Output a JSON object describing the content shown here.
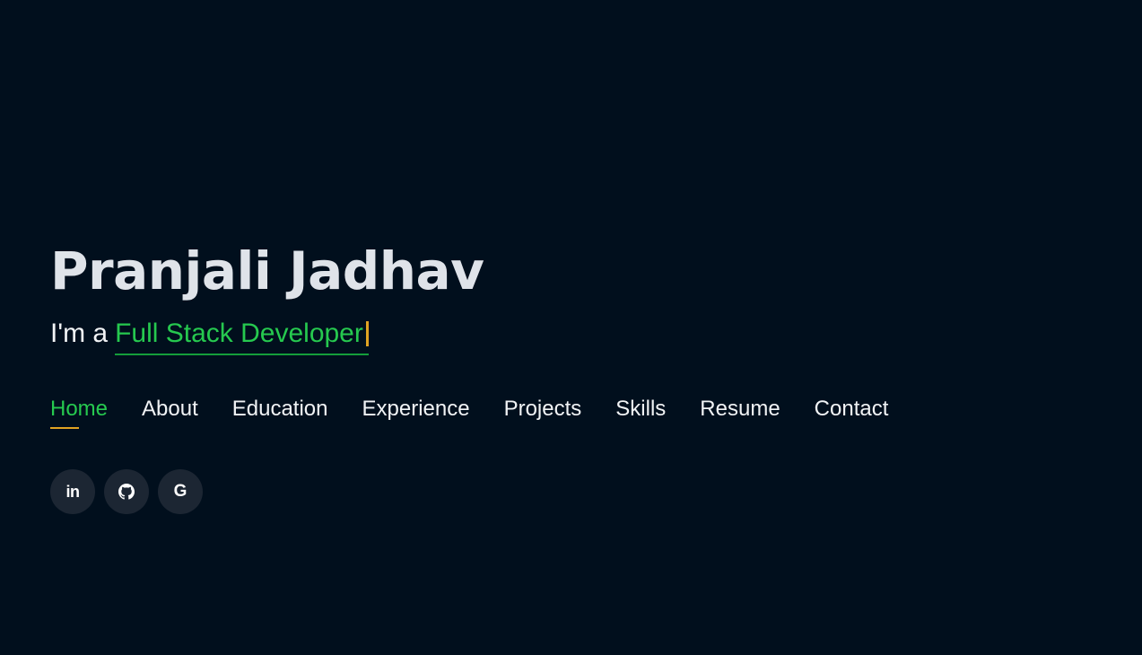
{
  "hero": {
    "name": "Pranjali Jadhav",
    "tagline_prefix": "I'm a",
    "typed_text": "Full Stack Developer"
  },
  "nav": {
    "items": [
      {
        "label": "Home",
        "active": true
      },
      {
        "label": "About"
      },
      {
        "label": "Education"
      },
      {
        "label": "Experience"
      },
      {
        "label": "Projects"
      },
      {
        "label": "Skills"
      },
      {
        "label": "Resume"
      },
      {
        "label": "Contact"
      }
    ]
  },
  "social": {
    "linkedin_glyph": "in",
    "google_glyph": "G",
    "icons": [
      "linkedin-icon",
      "github-icon",
      "google-icon"
    ]
  },
  "colors": {
    "background": "#010f1d",
    "accent_green": "#26c94f",
    "accent_gold": "#e1a322",
    "text": "#f1f3f5",
    "name_text": "#dfe3e9",
    "social_bg": "#1c2633"
  }
}
